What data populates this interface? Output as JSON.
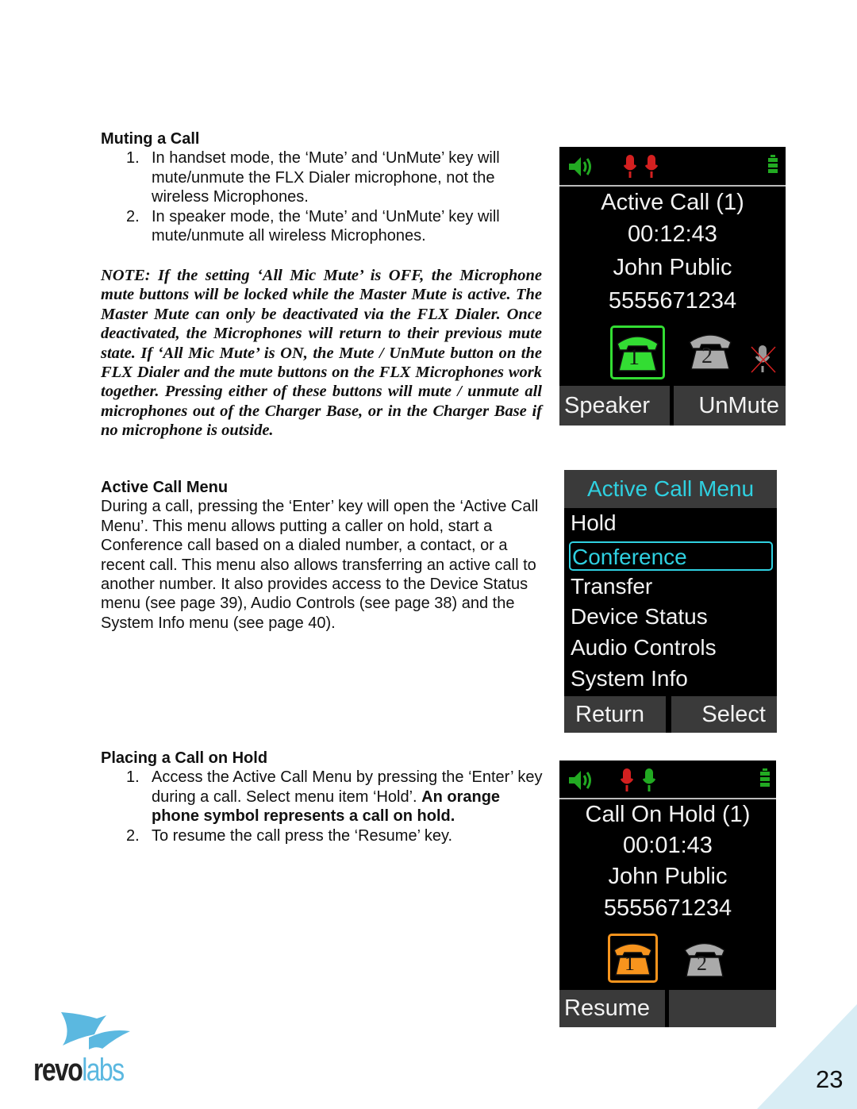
{
  "muting": {
    "heading": "Muting a Call",
    "items": [
      {
        "num": "1.",
        "text": "In handset mode, the ‘Mute’ and ‘UnMute’ key will mute/unmute the FLX Dialer microphone, not the wireless Microphones."
      },
      {
        "num": "2.",
        "text": "In speaker mode, the ‘Mute’ and ‘UnMute’ key will mute/unmute all wireless Microphones."
      }
    ],
    "note": "NOTE: If the setting ‘All Mic Mute’ is OFF, the Microphone mute buttons will be locked while the Master Mute is active. The Master Mute can only be deactivated via the FLX Dialer. Once deactivated, the Microphones will return to their previous mute state.  If ‘All Mic Mute’ is ON, the Mute / UnMute button on the FLX Dialer and the mute buttons on the FLX Microphones work together.  Pressing either of these buttons will mute / unmute all microphones out of the Charger Base, or in the Charger Base if no microphone is outside."
  },
  "active_menu": {
    "heading": "Active Call Menu",
    "body": "During a call, pressing the ‘Enter’ key will open the ‘Active Call Menu’.  This menu allows putting a caller on hold, start a Conference call based on a dialed number, a contact, or a recent call.  This menu also allows transferring an active call to another number.  It also provides access to the Device Status menu (see page 39), Audio Controls (see page 38) and the System Info menu (see page 40)."
  },
  "hold": {
    "heading": "Placing a Call on Hold",
    "item1_text": "Access the Active Call Menu by pressing the ‘Enter’ key during a call. Select menu item ‘Hold’.  ",
    "item1_bold": "An orange phone symbol represents a call on hold.",
    "item2_text": "To resume the call press the ‘Resume’ key.",
    "num1": "1.",
    "num2": "2."
  },
  "screen_active": {
    "title": "Active Call (1)",
    "time": "00:12:43",
    "name": "John Public",
    "number": "5555671234",
    "left_key": "Speaker",
    "right_key": "UnMute",
    "line1": "1",
    "line2": "2"
  },
  "screen_menu": {
    "title": "Active Call Menu",
    "items": [
      "Hold",
      "Conference",
      "Transfer",
      "Device Status",
      "Audio Controls",
      "System Info"
    ],
    "selected": "Conference",
    "left_key": "Return",
    "right_key": "Select"
  },
  "screen_hold": {
    "title": "Call On Hold (1)",
    "time": "00:01:43",
    "name": "John Public",
    "number": "5555671234",
    "left_key": "Resume",
    "line1": "1",
    "line2": "2"
  },
  "colors": {
    "active_green": "#33dd33",
    "hold_orange": "#f7941d",
    "menu_cyan": "#2fd0e0",
    "mic_red": "#d42020",
    "brand_blue": "#5bb8e0"
  },
  "logo": {
    "text_dark": "revo",
    "text_light": "labs"
  },
  "page_number": "23"
}
